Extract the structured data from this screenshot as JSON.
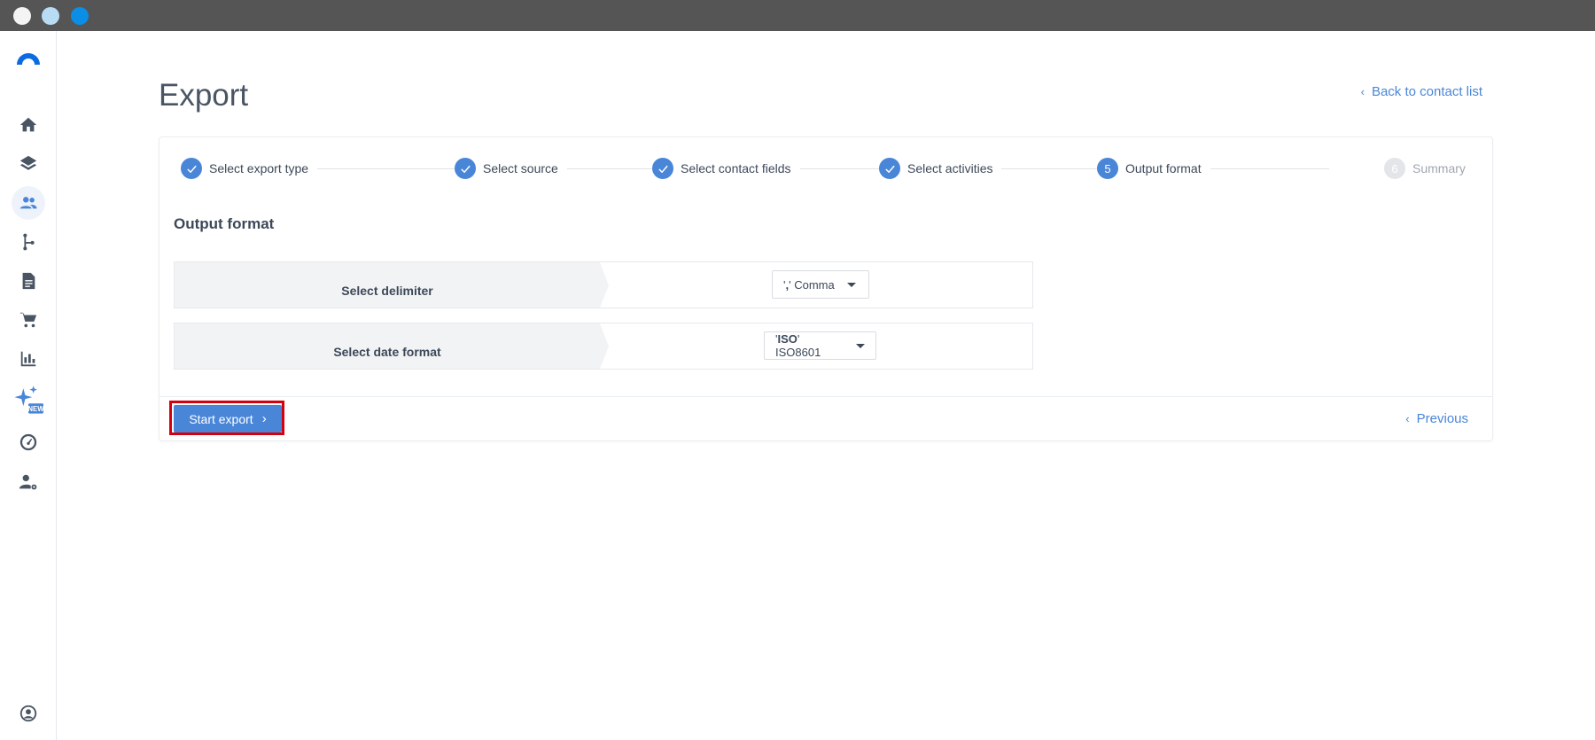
{
  "window": {
    "dots": [
      "close",
      "minimize",
      "maximize"
    ]
  },
  "sidebar": {
    "items": [
      {
        "icon": "home-icon"
      },
      {
        "icon": "layers-icon"
      },
      {
        "icon": "contacts-icon"
      },
      {
        "icon": "branch-icon"
      },
      {
        "icon": "document-icon"
      },
      {
        "icon": "cart-icon"
      },
      {
        "icon": "bar-chart-icon"
      },
      {
        "icon": "sparkle-icon",
        "badge": "NEW"
      },
      {
        "icon": "speedometer-icon"
      },
      {
        "icon": "user-settings-icon"
      }
    ],
    "bottom_icon": "account-icon",
    "active_index": 2,
    "accent": "#4a86d8"
  },
  "header": {
    "title": "Export",
    "back_link": "Back to contact list"
  },
  "stepper": {
    "steps": [
      {
        "label": "Select export type",
        "state": "done"
      },
      {
        "label": "Select source",
        "state": "done"
      },
      {
        "label": "Select contact fields",
        "state": "done"
      },
      {
        "label": "Select activities",
        "state": "done"
      },
      {
        "label": "Output format",
        "state": "current",
        "number": "5"
      },
      {
        "label": "Summary",
        "state": "pending",
        "number": "6"
      }
    ]
  },
  "form": {
    "section_title": "Output format",
    "delimiter": {
      "label": "Select delimiter",
      "value_bold": ",",
      "value_prefix": "'",
      "value_suffix": "' Comma"
    },
    "date_format": {
      "label": "Select date format",
      "value_prefix": "'",
      "value_bold": "ISO",
      "value_suffix": "' ISO8601"
    }
  },
  "footer": {
    "start_export": "Start export",
    "previous": "Previous"
  }
}
